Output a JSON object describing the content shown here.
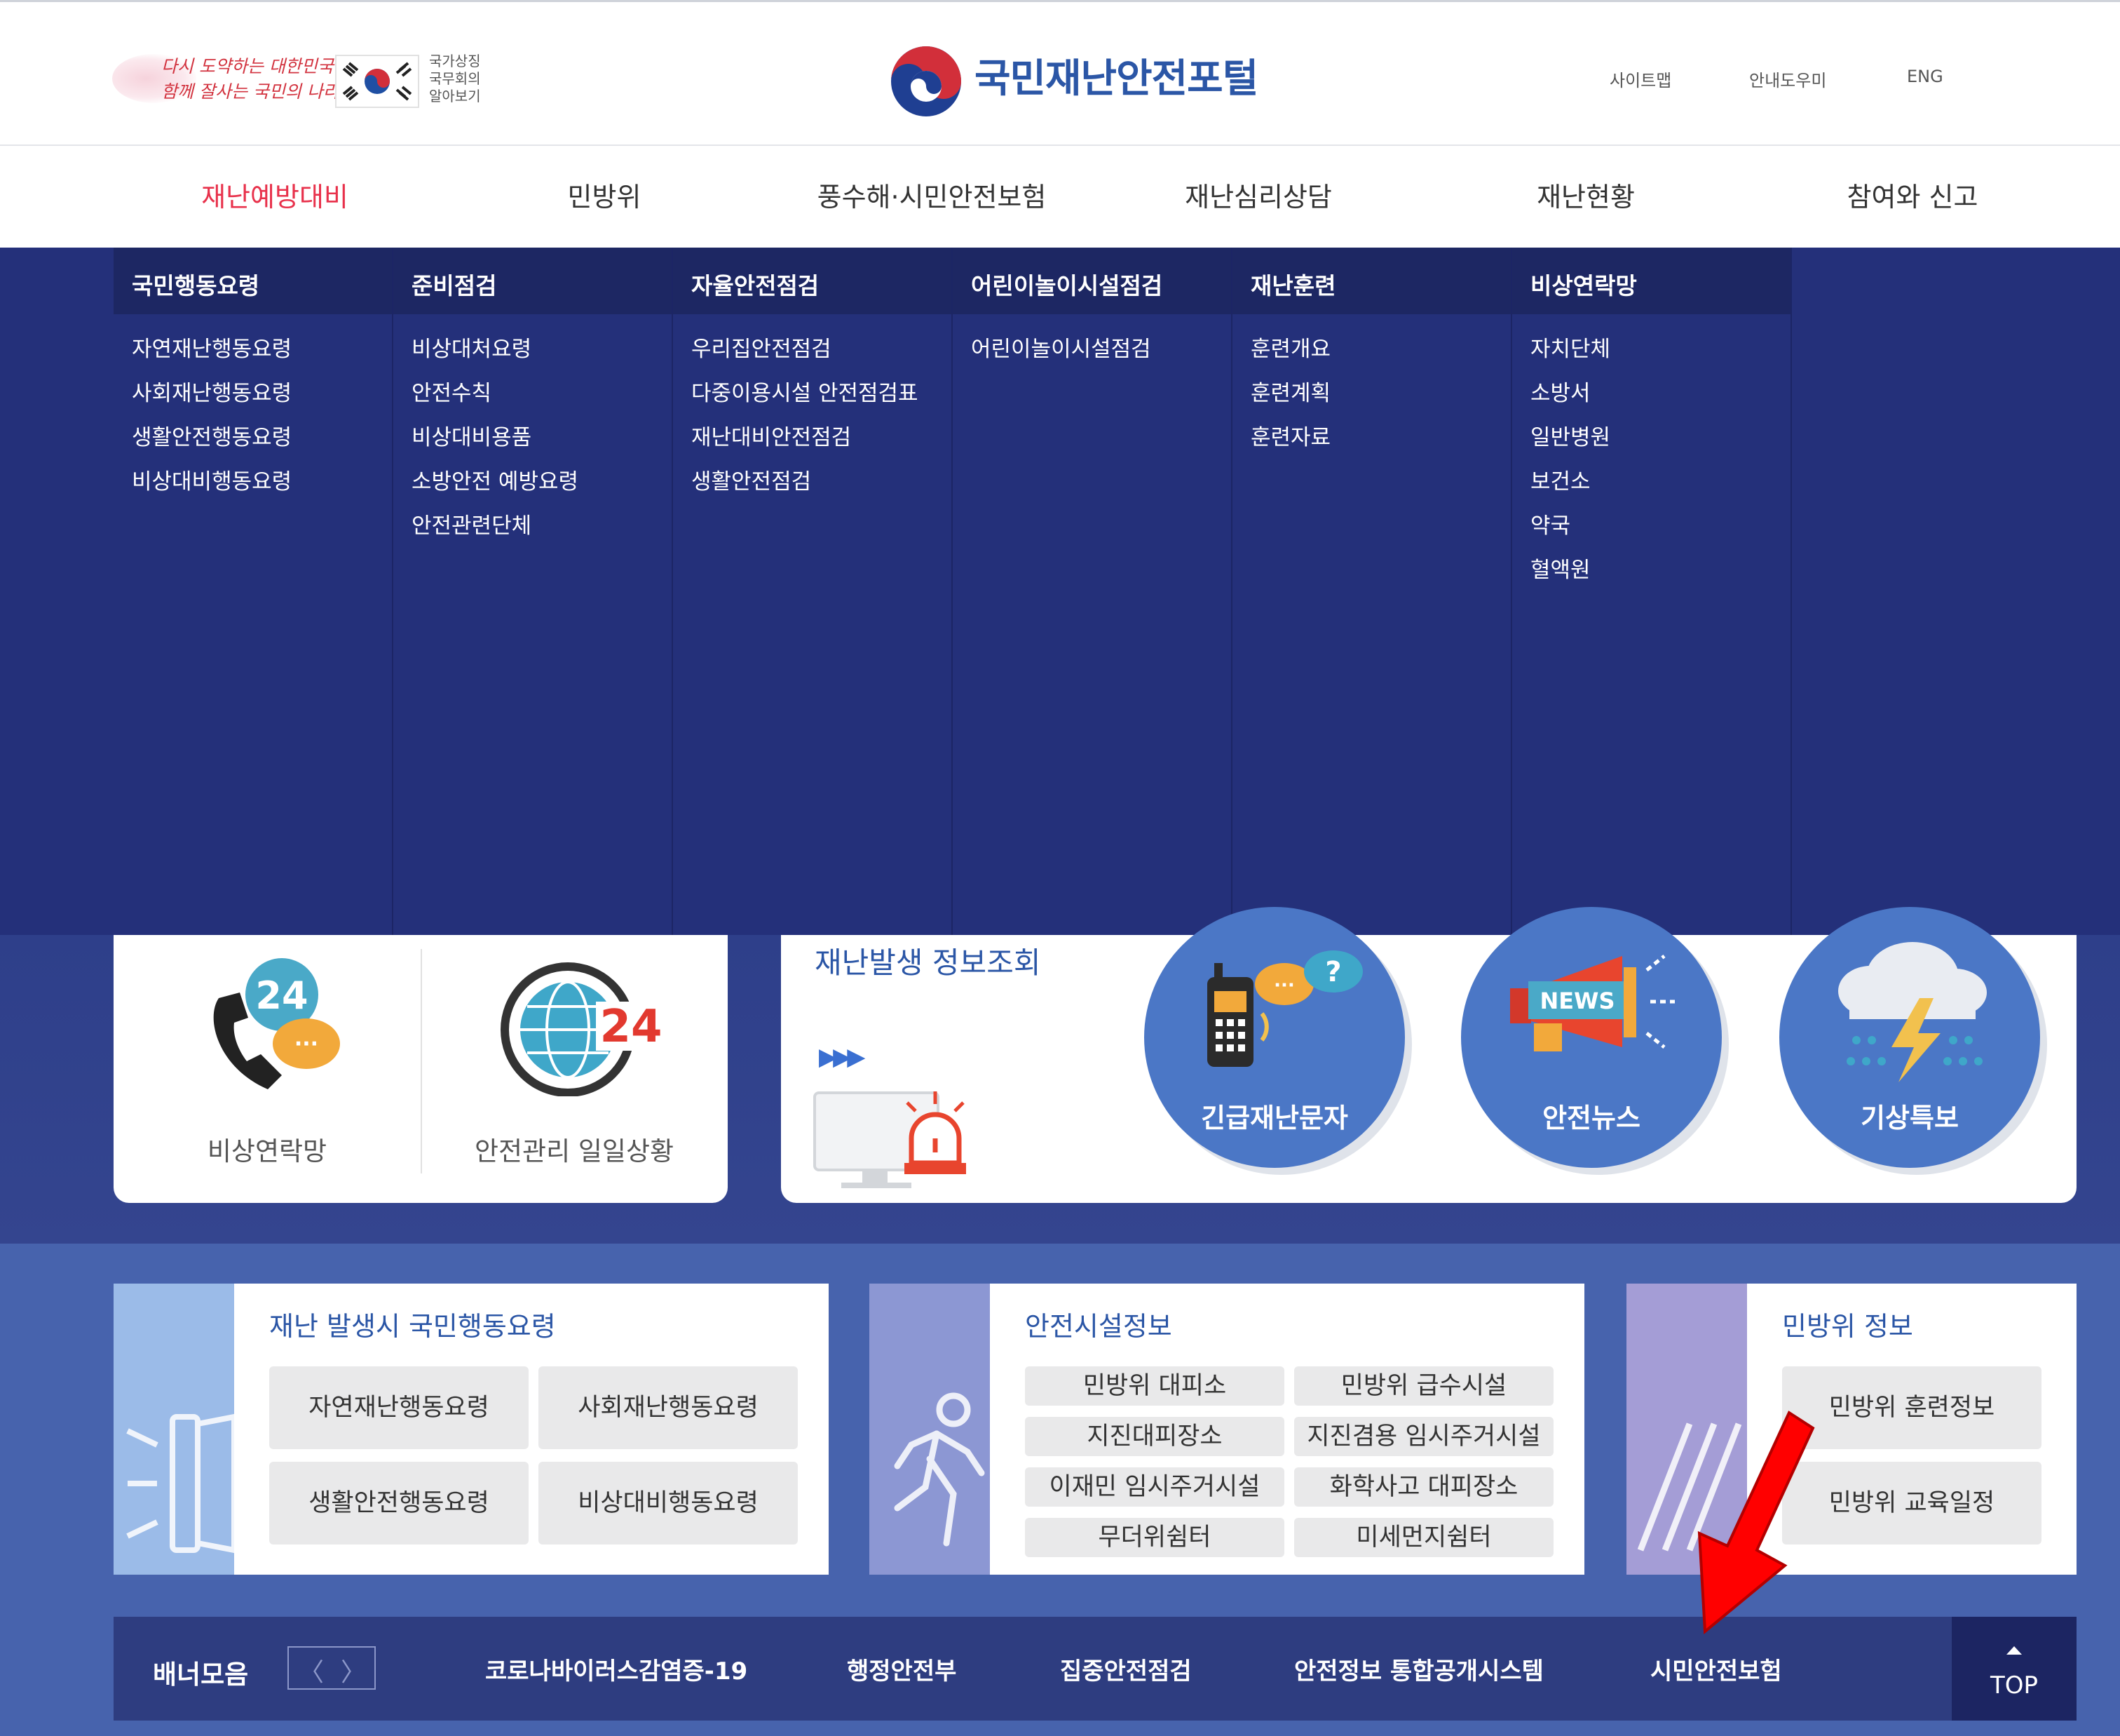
{
  "header": {
    "slogan_line1": "다시 도약하는 대한민국",
    "slogan_line2": "함께 잘사는 국민의 나라",
    "national_symbol_text": [
      "국가상징",
      "국무회의",
      "알아보기"
    ],
    "portal_title": "국민재난안전포털",
    "utility_links": [
      "사이트맵",
      "안내도우미",
      "ENG"
    ]
  },
  "nav": {
    "items": [
      "재난예방대비",
      "민방위",
      "풍수해·시민안전보험",
      "재난심리상담",
      "재난현황",
      "참여와 신고"
    ],
    "active_index": 0
  },
  "mega_menu": [
    {
      "title": "국민행동요령",
      "items": [
        "자연재난행동요령",
        "사회재난행동요령",
        "생활안전행동요령",
        "비상대비행동요령"
      ]
    },
    {
      "title": "준비점검",
      "items": [
        "비상대처요령",
        "안전수칙",
        "비상대비용품",
        "소방안전 예방요령",
        "안전관련단체"
      ]
    },
    {
      "title": "자율안전점검",
      "items": [
        "우리집안전점검",
        "다중이용시설 안전점검표",
        "재난대비안전점검",
        "생활안전점검"
      ]
    },
    {
      "title": "어린이놀이시설점검",
      "items": [
        "어린이놀이시설점검"
      ]
    },
    {
      "title": "재난훈련",
      "items": [
        "훈련개요",
        "훈련계획",
        "훈련자료"
      ]
    },
    {
      "title": "비상연락망",
      "items": [
        "자치단체",
        "소방서",
        "일반병원",
        "보건소",
        "약국",
        "혈액원"
      ]
    }
  ],
  "quick_left": [
    {
      "label": "비상연락망",
      "icon": "phone-24-icon",
      "badge": "24"
    },
    {
      "label": "안전관리 일일상황",
      "icon": "globe-24-icon",
      "badge": "24"
    }
  ],
  "disaster_info": {
    "title": "재난발생 정보조회",
    "arrows": "▶▶▶",
    "circles": [
      {
        "label": "긴급재난문자",
        "icon": "emergency-phone-icon"
      },
      {
        "label": "안전뉴스",
        "icon": "news-megaphone-icon",
        "badge": "NEWS"
      },
      {
        "label": "기상특보",
        "icon": "weather-storm-icon"
      }
    ]
  },
  "panels": {
    "action": {
      "title": "재난 발생시 국민행동요령",
      "buttons": [
        "자연재난행동요령",
        "사회재난행동요령",
        "생활안전행동요령",
        "비상대비행동요령"
      ]
    },
    "facilities": {
      "title": "안전시설정보",
      "buttons": [
        "민방위 대피소",
        "민방위 급수시설",
        "지진대피장소",
        "지진겸용 임시주거시설",
        "이재민 임시주거시설",
        "화학사고 대피장소",
        "무더위쉼터",
        "미세먼지쉼터"
      ]
    },
    "civil_defense": {
      "title": "민방위 정보",
      "buttons": [
        "민방위 훈련정보",
        "민방위 교육일정"
      ]
    }
  },
  "banner": {
    "label": "배너모음",
    "prev": "〈",
    "next": "〉",
    "links": [
      "코로나바이러스감염증-19",
      "행정안전부",
      "집중안전점검",
      "안전정보 통합공개시스템",
      "시민안전보험"
    ],
    "top_label": "TOP"
  },
  "colors": {
    "accent_red": "#e8314b",
    "mega_bg": "#24307a",
    "brand_blue": "#2b56a6",
    "circle_blue": "#4b77c6",
    "annotation_arrow": "#ff0000"
  }
}
